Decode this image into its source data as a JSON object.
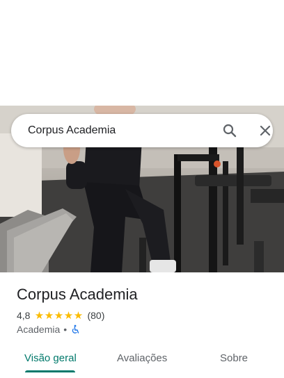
{
  "search": {
    "query": "Corpus Academia"
  },
  "place": {
    "name": "Corpus Academia",
    "rating": "4,8",
    "stars_filled": 5,
    "review_count": "(80)",
    "category": "Academia",
    "separator": "•"
  },
  "tabs": [
    {
      "label": "Visão geral",
      "active": true
    },
    {
      "label": "Avaliações",
      "active": false
    },
    {
      "label": "Sobre",
      "active": false
    }
  ],
  "colors": {
    "accent": "#00796b",
    "star": "#fbbc04",
    "accessible": "#1a73e8"
  },
  "icons": {
    "search": "search-icon",
    "close": "close-icon",
    "accessible": "wheelchair-icon"
  }
}
